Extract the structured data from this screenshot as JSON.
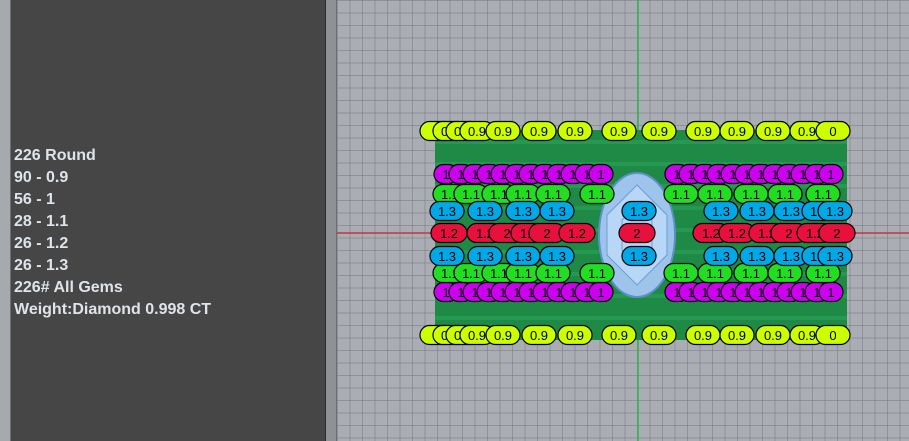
{
  "panel": {
    "lines": [
      "226 Round",
      "90 - 0.9",
      "56 - 1",
      "28 - 1.1",
      "26 - 1.2",
      "26 - 1.3",
      "",
      "226# All Gems",
      "Weight:Diamond 0.998 CT"
    ]
  },
  "colors": {
    "c09": "#ccff00",
    "c10": "#cc00ee",
    "c11": "#22dd22",
    "c12": "#e8103c",
    "c13": "#00a8e8",
    "green_axis": "#2fb34a",
    "red_axis": "#c8343c",
    "setting": "#1f8a45"
  },
  "gem_rows": [
    {
      "label": "0.9",
      "color": "c09",
      "slots": [
        "0",
        "0.9",
        "0.9",
        "0.9",
        "0.9",
        "0.9",
        "0.9",
        "0.9",
        "0.9",
        "0.9",
        "0.9",
        "0.9",
        "0.9"
      ]
    },
    {
      "label": "1",
      "color": "c10",
      "slots": [
        "1",
        "1",
        "1",
        "1",
        "1",
        "1",
        "1",
        "1",
        "1",
        "1",
        "1",
        "1",
        "1",
        "1"
      ]
    },
    {
      "label": "1.1",
      "color": "c11",
      "slots": [
        "1.1",
        "1.1",
        "1.1",
        "1.1",
        "1.1",
        "1.1",
        "1.1",
        "1.1",
        "1.1",
        "1.1"
      ]
    },
    {
      "label": "1.3",
      "color": "c13",
      "slots": [
        "1.3",
        "1.3",
        "1.3",
        "1.3",
        "1.3",
        "1.3",
        "1.3",
        "1.3",
        "1.3",
        "1.3"
      ]
    },
    {
      "label": "1.2",
      "color": "c12",
      "slots": [
        "1.2",
        "1.2",
        "2",
        "1.2",
        "2",
        "1.2",
        "2",
        "1.2",
        "1.2",
        "1.2",
        "2",
        "1.2",
        "2"
      ]
    }
  ]
}
